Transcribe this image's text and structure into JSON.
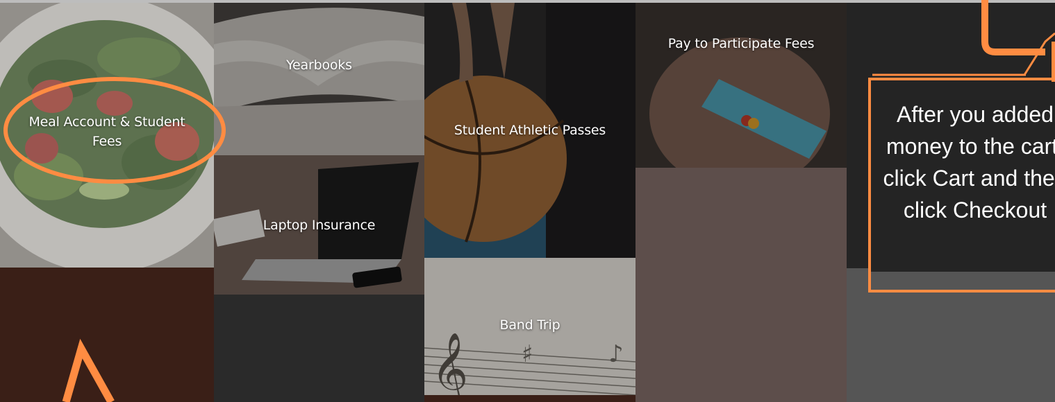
{
  "tiles": {
    "meal": "Meal Account & Student Fees",
    "yearbooks": "Yearbooks",
    "laptop": "Laptop Insurance",
    "athletic": "Student Athletic Passes",
    "band": "Band Trip",
    "pay": "Pay to Participate Fees"
  },
  "callout": {
    "text": "After you added money to the cart, click Cart and then click Checkout"
  },
  "colors": {
    "annotation": "#ff8c42",
    "dark_brown": "#3a1f17",
    "charcoal": "#2a2a2a",
    "taupe": "#5d4e4b",
    "gray": "#555555"
  },
  "icons": {
    "arrow_up": "arrow-up-icon",
    "highlight": "highlight-ellipse",
    "pointer": "pointer-arrow"
  }
}
